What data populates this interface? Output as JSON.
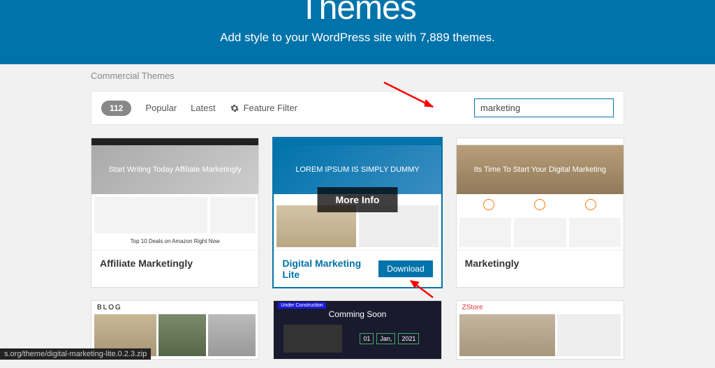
{
  "hero": {
    "title": "Themes",
    "subtitle": "Add style to your WordPress site with 7,889 themes."
  },
  "subnav": {
    "commercial": "Commercial Themes"
  },
  "filter": {
    "count": "112",
    "tabs": {
      "popular": "Popular",
      "latest": "Latest",
      "feature": "Feature Filter"
    },
    "search_value": "marketing"
  },
  "themes": [
    {
      "title": "Affiliate Marketingly",
      "hero_text": "Start Writing Today\nAffiliate Marketingly"
    },
    {
      "title": "Digital Marketing Lite",
      "hero_text": "LOREM IPSUM IS SIMPLY DUMMY"
    },
    {
      "title": "Marketingly",
      "hero_text": "Its Time To Start Your\nDigital Marketing"
    }
  ],
  "hover": {
    "more_info": "More Info",
    "download": "Download"
  },
  "row2_labels": {
    "blog": "BLOG",
    "coming": "Comming Soon",
    "under": "Under Construction",
    "date": "01  Jan,  2021",
    "zstore": "ZStore"
  },
  "status": "s.org/theme/digital-marketing-lite.0.2.3.zip"
}
